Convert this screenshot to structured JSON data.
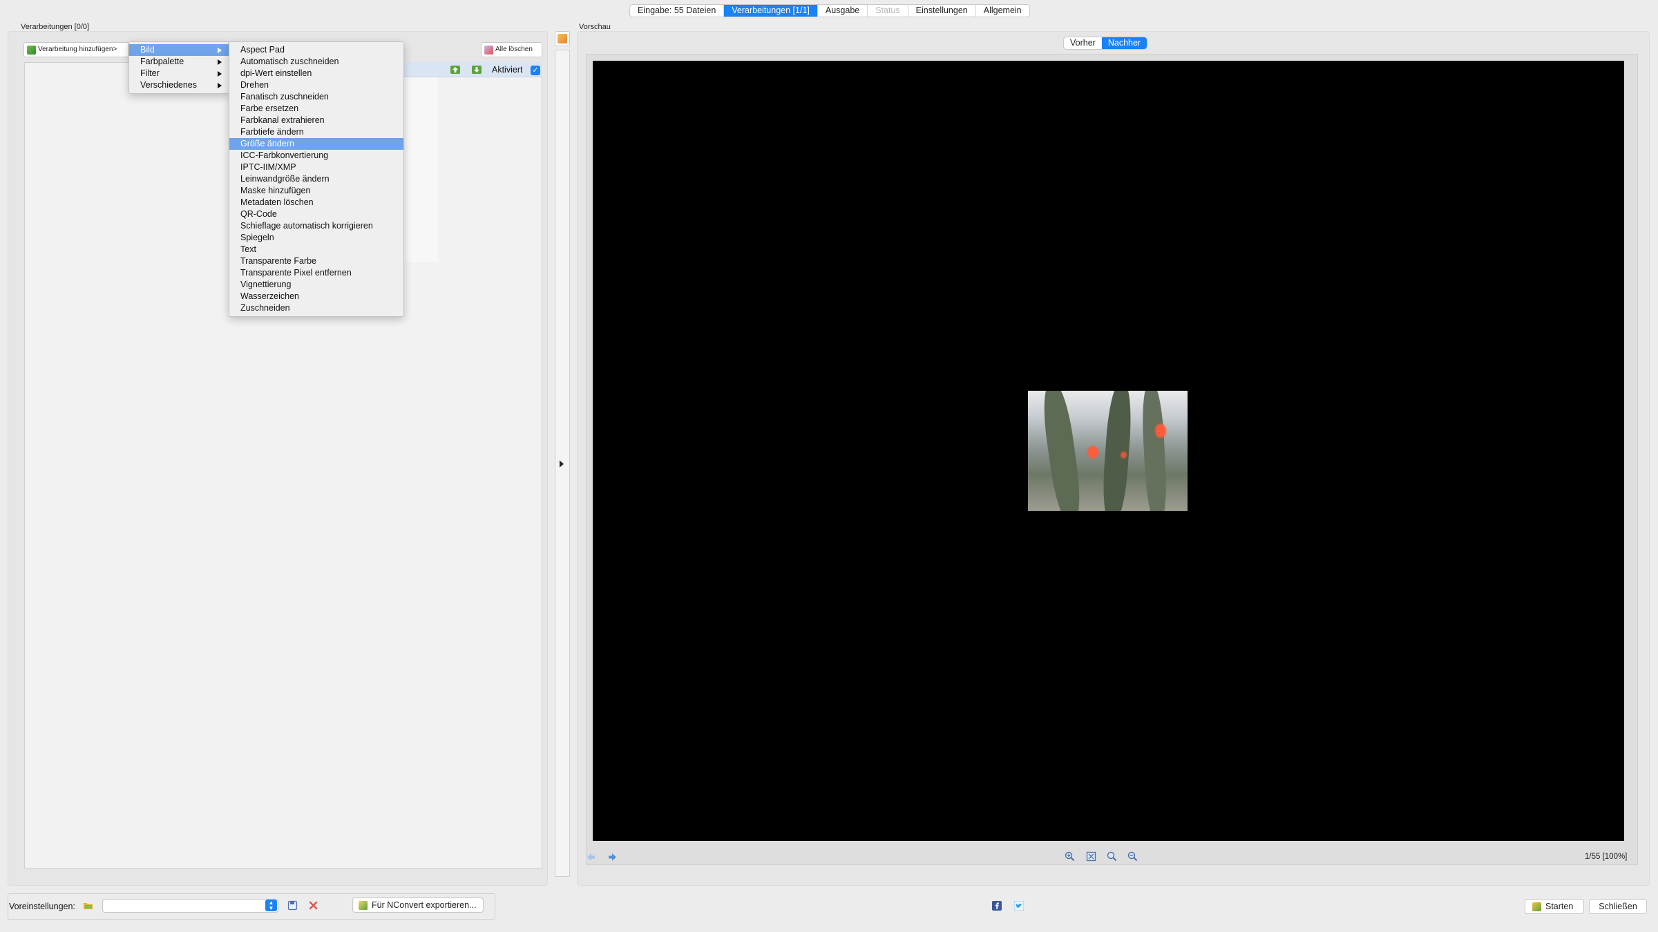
{
  "top_tabs": [
    {
      "label": "Eingabe: 55 Dateien",
      "state": "normal"
    },
    {
      "label": "Verarbeitungen [1/1]",
      "state": "active"
    },
    {
      "label": "Ausgabe",
      "state": "normal"
    },
    {
      "label": "Status",
      "state": "disabled"
    },
    {
      "label": "Einstellungen",
      "state": "normal"
    },
    {
      "label": "Allgemein",
      "state": "normal"
    }
  ],
  "left_panel": {
    "title": "Verarbeitungen [0/0]",
    "add_button": "Verarbeitung hinzufügen>",
    "clear_all_button": "Alle löschen",
    "activated_label": "Aktiviert",
    "activated_checked": true
  },
  "preview": {
    "title": "Vorschau",
    "segments": [
      {
        "label": "Vorher",
        "active": false
      },
      {
        "label": "Nachher",
        "active": true
      }
    ],
    "counter": "1/55 [100%]"
  },
  "category_menu": {
    "items": [
      {
        "label": "Bild",
        "highlighted": true
      },
      {
        "label": "Farbpalette",
        "highlighted": false
      },
      {
        "label": "Filter",
        "highlighted": false
      },
      {
        "label": "Verschiedenes",
        "highlighted": false
      }
    ]
  },
  "bild_submenu": {
    "items": [
      "Aspect Pad",
      "Automatisch zuschneiden",
      "dpi-Wert einstellen",
      "Drehen",
      "Fanatisch zuschneiden",
      "Farbe ersetzen",
      "Farbkanal extrahieren",
      "Farbtiefe ändern",
      "Größe ändern",
      "ICC-Farbkonvertierung",
      "IPTC-IIM/XMP",
      "Leinwandgröße ändern",
      "Maske hinzufügen",
      "Metadaten löschen",
      "QR-Code",
      "Schieflage automatisch korrigieren",
      "Spiegeln",
      "Text",
      "Transparente Farbe",
      "Transparente Pixel entfernen",
      "Vignettierung",
      "Wasserzeichen",
      "Zuschneiden"
    ],
    "highlighted": "Größe ändern"
  },
  "bottom": {
    "presets_label": "Voreinstellungen:",
    "preset_value": "",
    "export_button": "Für NConvert exportieren...",
    "start_button": "Starten",
    "close_button": "Schließen"
  },
  "colors": {
    "accent": "#1a82f7",
    "menu_highlight": "#6fa4ea",
    "canvas": "#000000"
  }
}
